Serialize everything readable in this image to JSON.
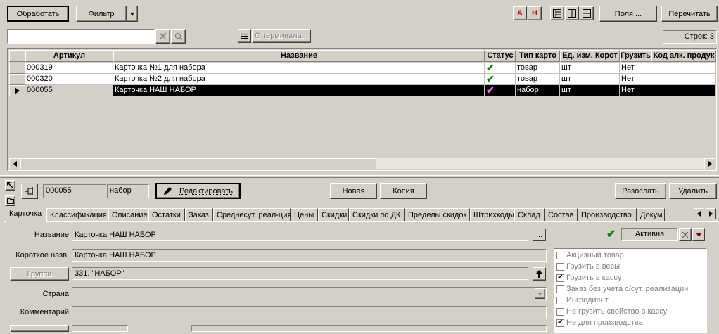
{
  "toolbar": {
    "process_label": "Обработать",
    "filter_label": "Фильтр",
    "filter_arrow": "▼",
    "red_a": "А",
    "red_n": "Н",
    "fields_label": "Поля ...",
    "recalc_label": "Перечитать",
    "terminal_label": "С терминала...",
    "rows_label": "Строк: 3",
    "search_placeholder": ""
  },
  "grid": {
    "columns": [
      "Артикул",
      "Название",
      "Статус",
      "Тип карто",
      "Ед. изм. Корот",
      "Грузить",
      "Код алк. продук"
    ],
    "rows": [
      {
        "article": "000319",
        "name": "Карточка №1 для набора",
        "status": "✔",
        "type": "товар",
        "unit": "шт",
        "load": "Нет",
        "alc": "",
        "selected": false
      },
      {
        "article": "000320",
        "name": "Карточка №2 для набора",
        "status": "✔",
        "type": "товар",
        "unit": "шт",
        "load": "Нет",
        "alc": "",
        "selected": false
      },
      {
        "article": "000055",
        "name": "Карточка НАШ НАБОР",
        "status": "✔",
        "type": "набор",
        "unit": "шт",
        "load": "Нет",
        "alc": "",
        "selected": true
      }
    ]
  },
  "detail": {
    "code": "000055",
    "kind": "набор",
    "edit_label": "Редактировать",
    "new_label": "Новая",
    "copy_label": "Копия",
    "send_label": "Разослать",
    "delete_label": "Удалить"
  },
  "tabs": [
    "Карточка",
    "Классификация",
    "Описание",
    "Остатки",
    "Заказ",
    "Среднесут. реал-ция",
    "Цены",
    "Скидки",
    "Скидки по ДК",
    "Пределы скидок",
    "Штрихкоды",
    "Склад",
    "Состав",
    "Производство",
    "Докум"
  ],
  "form": {
    "name_label": "Название",
    "name_value": "Карточка НАШ НАБОР",
    "short_label": "Короткое назв.",
    "short_value": "Карточка НАШ НАБОР",
    "group_button": "Группа",
    "group_value": "331. \"НАБОР\"",
    "country_label": "Страна",
    "country_value": "",
    "comment_label": "Комментарий",
    "comment_value": "",
    "ellipsis": "...",
    "status_value": "Активна"
  },
  "checks": [
    {
      "label": "Акцизный товар",
      "checked": false,
      "enabled": false
    },
    {
      "label": "Грузить в весы",
      "checked": false,
      "enabled": false
    },
    {
      "label": "Грузить в кассу",
      "checked": true,
      "enabled": false
    },
    {
      "label": "Заказ без учета с/сут. реализации",
      "checked": false,
      "enabled": false
    },
    {
      "label": "Ингредиент",
      "checked": false,
      "enabled": false
    },
    {
      "label": "Не грузить свойство в кассу",
      "checked": false,
      "enabled": false
    },
    {
      "label": "Не для производства",
      "checked": true,
      "enabled": false
    }
  ],
  "colors": {
    "check_green": "#008000",
    "check_pink": "#ff66ff",
    "red_text": "#cc0000",
    "dropdown_red": "#800000"
  }
}
